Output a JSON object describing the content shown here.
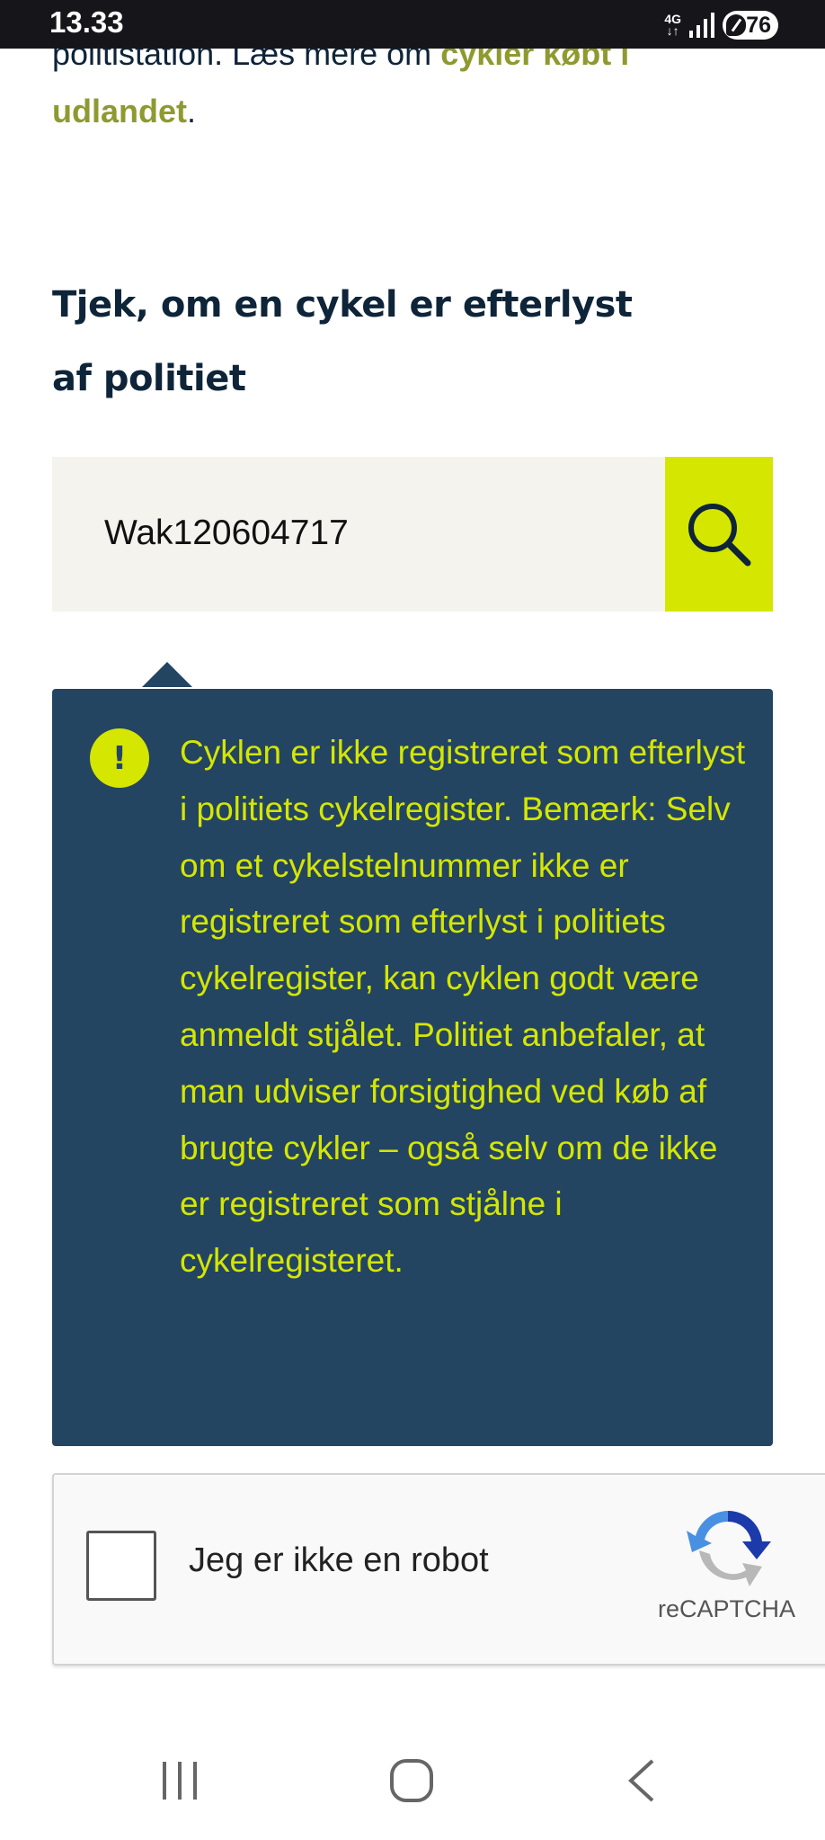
{
  "status_bar": {
    "time": "13.33",
    "network": "4G",
    "battery": "76"
  },
  "intro": {
    "text_before": "politistation. Læs mere om ",
    "link_text_part1": "cykler købt i",
    "link_text_part2": "udlandet",
    "text_after": "."
  },
  "check_section": {
    "title": "Tjek, om en cykel er efterlyst af politiet",
    "search_value": "Wak120604717",
    "search_icon": "search-icon"
  },
  "result": {
    "icon_glyph": "!",
    "message": "Cyklen er ikke registreret som efterlyst i politiets cykelregister. Bemærk: Selv om et cykelstelnummer ikke er registreret som efterlyst i politiets cykelregister, kan cyklen godt være anmeldt stjålet. Politiet anbefaler, at man udviser forsigtighed ved køb af brugte cykler – også selv om de ikke er registreret som stjålne i cykelregisteret."
  },
  "recaptcha": {
    "label": "Jeg er ikke en robot",
    "brand": "reCAPTCHA"
  },
  "colors": {
    "accent_yellow": "#d5e600",
    "panel_navy": "#234562",
    "link_olive": "#8e9a30",
    "heading_navy": "#0e2438"
  }
}
